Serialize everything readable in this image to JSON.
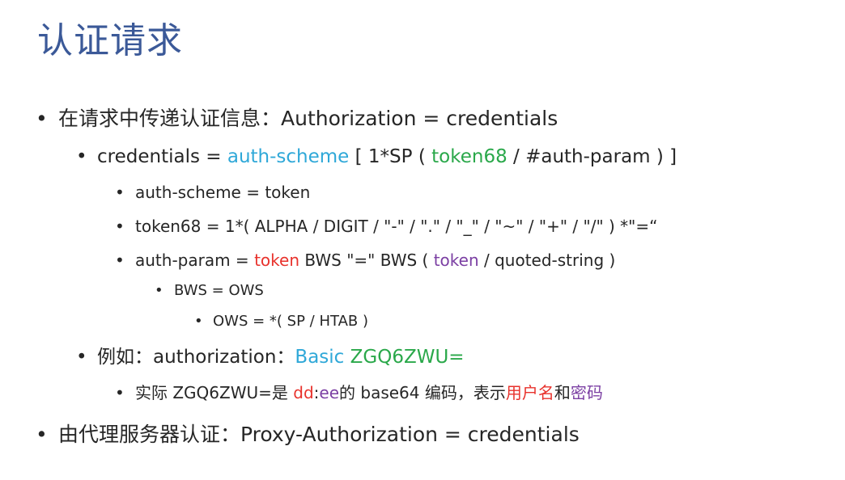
{
  "title": "认证请求",
  "bullet_char": "•",
  "b1": {
    "text": "在请求中传递认证信息：Authorization = credentials"
  },
  "b2": {
    "p1": "credentials = ",
    "auth_scheme": "auth-scheme",
    "p2": " [ 1*SP ( ",
    "token68": "token68",
    "p3": " / #auth-param ) ]"
  },
  "b3": {
    "text": "auth-scheme = token"
  },
  "b4": {
    "text": "token68 = 1*( ALPHA / DIGIT / \"-\" / \".\" / \"_\" / \"~\" / \"+\" / \"/\" ) *\"=“"
  },
  "b5": {
    "p1": "auth-param = ",
    "token1": "token",
    "p2": " BWS \"=\" BWS ( ",
    "token2": "token",
    "p3": " / quoted-string )"
  },
  "b6": {
    "text": "BWS = OWS"
  },
  "b7": {
    "text": "OWS = *( SP / HTAB )"
  },
  "b8": {
    "p1": "例如：authorization：",
    "basic": "Basic",
    "space": " ",
    "value": "ZGQ6ZWU="
  },
  "b9": {
    "p1": "实际 ZGQ6ZWU=是 ",
    "dd": "dd",
    "colon": ":",
    "ee": "ee",
    "p2": "的 base64 编码，表示",
    "username": "用户名",
    "and": "和",
    "password": "密码"
  },
  "b10": {
    "text": "由代理服务器认证：Proxy-Authorization = credentials"
  },
  "colors": {
    "title": "#3b5998",
    "blue": "#2fa8d8",
    "green": "#2aa84a",
    "red": "#e8322c",
    "purple": "#7b3fa3"
  }
}
